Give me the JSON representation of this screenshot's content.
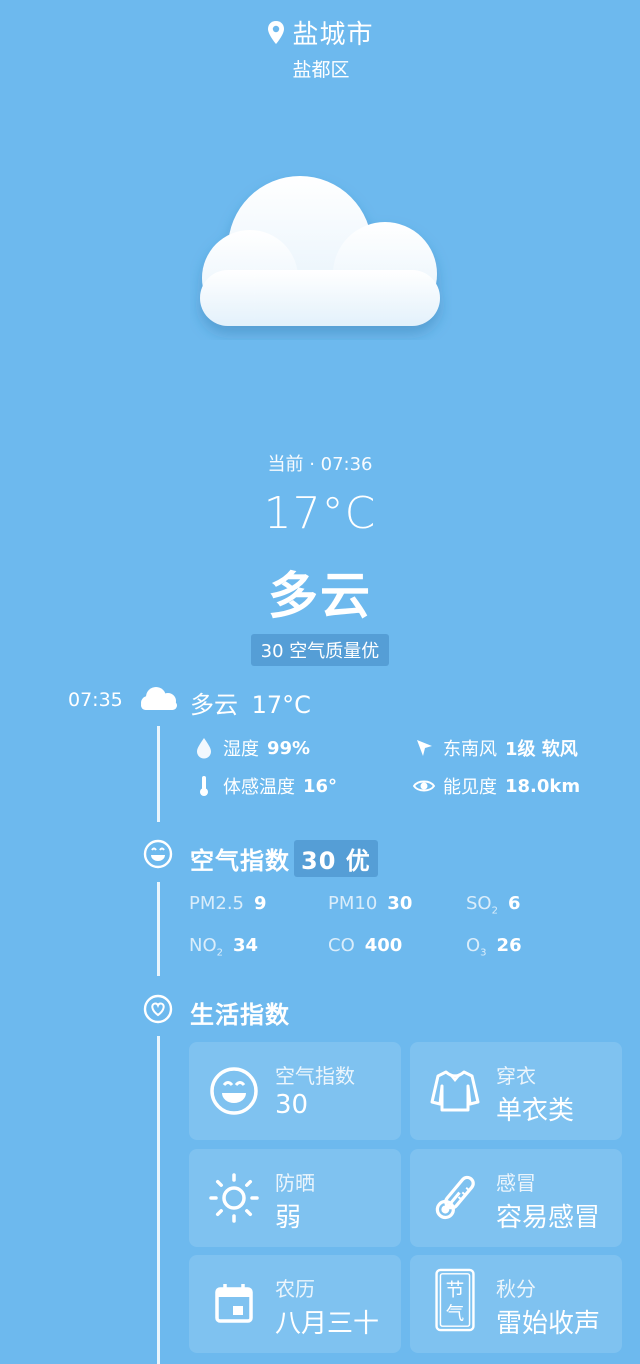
{
  "location": {
    "city": "盐城市",
    "district": "盐都区"
  },
  "current": {
    "time_label": "当前 · 07:36",
    "temperature": "17°C",
    "condition": "多云",
    "aqi_label": "30 空气质量优"
  },
  "hourly": {
    "time": "07:35",
    "condition": "多云",
    "temperature": "17°C",
    "humidity_label": "湿度",
    "humidity_value": "99%",
    "wind_label": "东南风",
    "wind_value": "1级 软风",
    "feels_label": "体感温度",
    "feels_value": "16°",
    "visibility_label": "能见度",
    "visibility_value": "18.0km"
  },
  "air_section": {
    "title": "空气指数",
    "badge": "30 优",
    "items": [
      {
        "name": "PM2.5",
        "sub": "",
        "value": "9"
      },
      {
        "name": "PM10",
        "sub": "",
        "value": "30"
      },
      {
        "name": "SO",
        "sub": "2",
        "value": "6"
      },
      {
        "name": "NO",
        "sub": "2",
        "value": "34"
      },
      {
        "name": "CO",
        "sub": "",
        "value": "400"
      },
      {
        "name": "O",
        "sub": "3",
        "value": "26"
      }
    ]
  },
  "life_section": {
    "title": "生活指数",
    "cards": [
      {
        "label": "空气指数",
        "value": "30",
        "icon": "smiley-icon"
      },
      {
        "label": "穿衣",
        "value": "单衣类",
        "icon": "shirt-icon"
      },
      {
        "label": "防晒",
        "value": "弱",
        "icon": "sun-icon"
      },
      {
        "label": "感冒",
        "value": "容易感冒",
        "icon": "thermometer-icon"
      },
      {
        "label": "农历",
        "value": "八月三十",
        "icon": "calendar-icon"
      },
      {
        "label": "秋分",
        "value": "雷始收声",
        "icon": "solar-term-icon",
        "icon_text": [
          "节",
          "气"
        ]
      }
    ]
  },
  "colors": {
    "background": "#6db9ee",
    "text": "#ffffff"
  }
}
